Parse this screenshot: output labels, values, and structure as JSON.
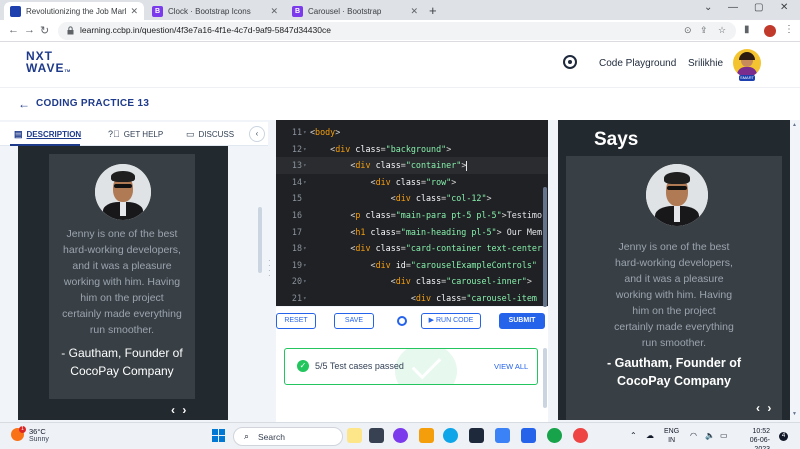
{
  "browser": {
    "tabs": [
      {
        "title": "Revolutionizing the Job Market |",
        "favicon": "ccbp-favicon",
        "active": true
      },
      {
        "title": "Clock · Bootstrap Icons",
        "favicon": "bootstrap-favicon",
        "active": false
      },
      {
        "title": "Carousel · Bootstrap",
        "favicon": "bootstrap-favicon",
        "active": false
      }
    ],
    "new_tab": "+",
    "url": "learning.ccbp.in/question/4f3e7a16-4f1e-4c7d-9af9-5847d34430ce"
  },
  "header": {
    "logo_line1": "NXT",
    "logo_line2": "WAVE",
    "logo_tm": "TM",
    "code_playground": "Code Playground",
    "user_name": "Srilikhie",
    "avatar_badge": "SMART"
  },
  "page": {
    "title": "CODING PRACTICE 13"
  },
  "left_tabs": {
    "description": "DESCRIPTION",
    "get_help": "GET HELP",
    "discuss": "DISCUSS",
    "collapse": "‹"
  },
  "testimonial": {
    "quote_lines": [
      "Jenny is one of the best",
      "hard-working developers,",
      "and it was a pleasure",
      "working with him. Having",
      "him on the project",
      "certainly made everything",
      "run smoother."
    ],
    "author_lines": [
      "- Gautham, Founder of",
      "CocoPay Company"
    ],
    "carousel_controls": "‹ ›"
  },
  "right_preview": {
    "heading": "Says"
  },
  "editor": {
    "lines": [
      {
        "num": "11",
        "fold": true,
        "tokens": [
          [
            "p",
            "<"
          ],
          [
            "tag",
            "body"
          ],
          [
            "p",
            ">"
          ]
        ]
      },
      {
        "num": "12",
        "fold": true,
        "tokens": [
          [
            "p",
            "    <"
          ],
          [
            "tag",
            "div"
          ],
          [
            "p",
            " "
          ],
          [
            "attr",
            "class"
          ],
          [
            "p",
            "="
          ],
          [
            "str",
            "\"background\""
          ],
          [
            "p",
            ">"
          ]
        ]
      },
      {
        "num": "13",
        "fold": true,
        "cursor": true,
        "tokens": [
          [
            "p",
            "        <"
          ],
          [
            "tag",
            "div"
          ],
          [
            "p",
            " "
          ],
          [
            "attr",
            "class"
          ],
          [
            "p",
            "="
          ],
          [
            "str",
            "\"container\""
          ],
          [
            "p",
            ">"
          ]
        ]
      },
      {
        "num": "14",
        "fold": true,
        "tokens": [
          [
            "p",
            "            <"
          ],
          [
            "tag",
            "div"
          ],
          [
            "p",
            " "
          ],
          [
            "attr",
            "class"
          ],
          [
            "p",
            "="
          ],
          [
            "str",
            "\"row\""
          ],
          [
            "p",
            ">"
          ]
        ]
      },
      {
        "num": "15",
        "fold": false,
        "tokens": [
          [
            "p",
            "                <"
          ],
          [
            "tag",
            "div"
          ],
          [
            "p",
            " "
          ],
          [
            "attr",
            "class"
          ],
          [
            "p",
            "="
          ],
          [
            "str",
            "\"col-12\""
          ],
          [
            "p",
            ">"
          ]
        ]
      },
      {
        "num": "16",
        "fold": false,
        "tokens": [
          [
            "p",
            "        <"
          ],
          [
            "tag",
            "p"
          ],
          [
            "p",
            " "
          ],
          [
            "attr",
            "class"
          ],
          [
            "p",
            "="
          ],
          [
            "str",
            "\"main-para pt-5 pl-5\""
          ],
          [
            "p",
            ">"
          ],
          [
            "txt",
            "Testimo"
          ]
        ]
      },
      {
        "num": "17",
        "fold": false,
        "tokens": [
          [
            "p",
            "        <"
          ],
          [
            "tag",
            "h1"
          ],
          [
            "p",
            " "
          ],
          [
            "attr",
            "class"
          ],
          [
            "p",
            "="
          ],
          [
            "str",
            "\"main-heading pl-5\""
          ],
          [
            "p",
            ">"
          ],
          [
            "txt",
            " Our Mem"
          ]
        ]
      },
      {
        "num": "18",
        "fold": true,
        "tokens": [
          [
            "p",
            "        <"
          ],
          [
            "tag",
            "div"
          ],
          [
            "p",
            " "
          ],
          [
            "attr",
            "class"
          ],
          [
            "p",
            "="
          ],
          [
            "str",
            "\"card-container text-center"
          ]
        ]
      },
      {
        "num": "19",
        "fold": true,
        "tokens": [
          [
            "p",
            "            <"
          ],
          [
            "tag",
            "div"
          ],
          [
            "p",
            " "
          ],
          [
            "attr",
            "id"
          ],
          [
            "p",
            "="
          ],
          [
            "str",
            "\"carouselExampleControls\""
          ]
        ]
      },
      {
        "num": "20",
        "fold": true,
        "tokens": [
          [
            "p",
            "                <"
          ],
          [
            "tag",
            "div"
          ],
          [
            "p",
            " "
          ],
          [
            "attr",
            "class"
          ],
          [
            "p",
            "="
          ],
          [
            "str",
            "\"carousel-inner\""
          ],
          [
            "p",
            ">"
          ]
        ]
      },
      {
        "num": "21",
        "fold": true,
        "tokens": [
          [
            "p",
            "                    <"
          ],
          [
            "tag",
            "div"
          ],
          [
            "p",
            " "
          ],
          [
            "attr",
            "class"
          ],
          [
            "p",
            "="
          ],
          [
            "str",
            "\"carousel-item"
          ]
        ]
      }
    ]
  },
  "actions": {
    "reset": "RESET",
    "save": "SAVE",
    "run_code": "▶ RUN CODE",
    "submit": "SUBMIT"
  },
  "results": {
    "summary": "5/5 Test cases passed",
    "view_all": "VIEW ALL"
  },
  "taskbar": {
    "temperature": "36°C",
    "weather": "Sunny",
    "weather_badge": "1",
    "search_placeholder": "Search",
    "lang_line1": "ENG",
    "lang_line2": "IN",
    "time": "10:52",
    "date": "06-06-2023",
    "notification_count": "4"
  },
  "colors": {
    "brand": "#1e3a8a",
    "accent": "#2563eb",
    "success": "#22c55e",
    "preview_bg": "#22292f",
    "card_bg": "#384045",
    "editor_bg": "#202124"
  }
}
